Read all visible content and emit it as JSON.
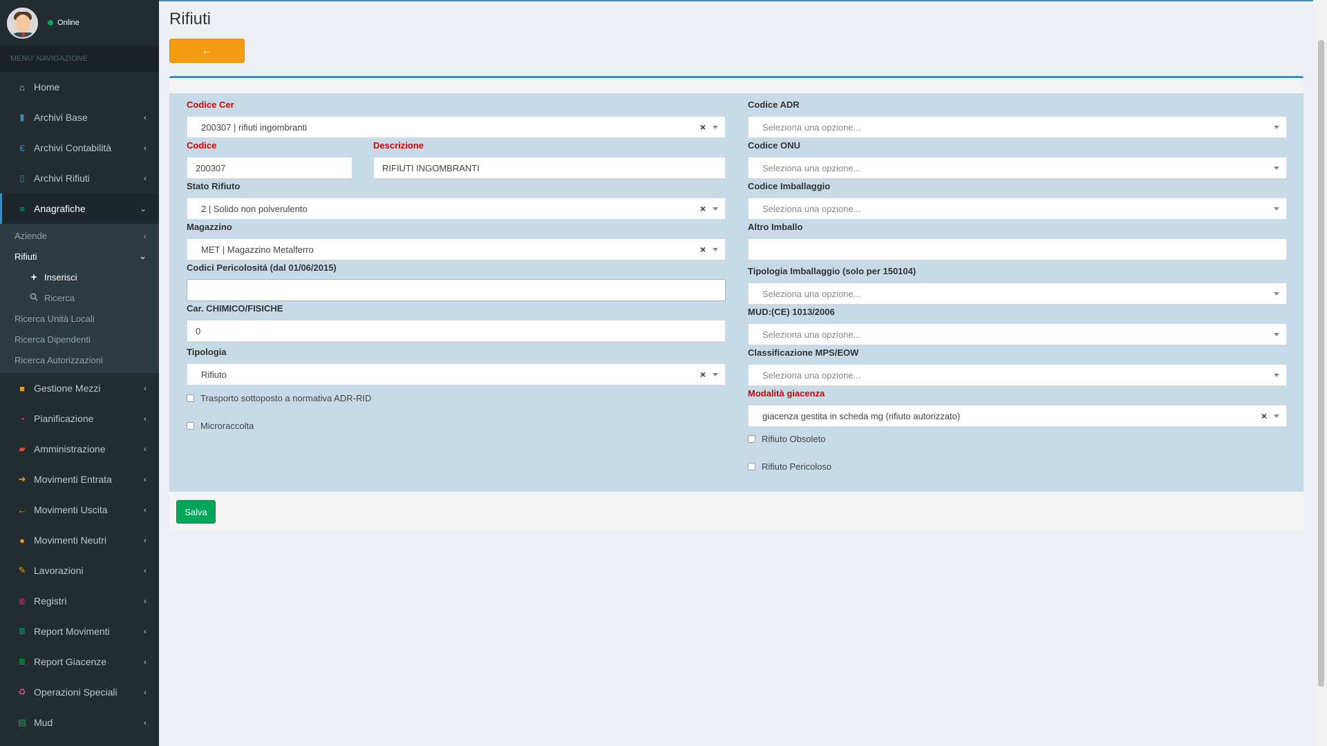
{
  "sidebar": {
    "status": "Online",
    "menu_header": "MENU' NAVIGAZIONE",
    "items": [
      {
        "label": "Home",
        "icon": "home-icon",
        "glyph": "⌂",
        "color": "#b8c7ce"
      },
      {
        "label": "Archivi Base",
        "icon": "book-icon",
        "glyph": "▮",
        "color": "#3c8dbc"
      },
      {
        "label": "Archivi Contabilità",
        "icon": "euro-icon",
        "glyph": "€",
        "color": "#3c8dbc"
      },
      {
        "label": "Archivi Rifiuti",
        "icon": "trash-icon",
        "glyph": "▯",
        "color": "#3c8dbc"
      },
      {
        "label": "Anagrafiche",
        "icon": "list-icon",
        "glyph": "≡",
        "color": "#00a65a"
      }
    ],
    "submenu": {
      "aziende": "Aziende",
      "rifiuti": "Rifiuti",
      "inserisci": "Inserisci",
      "ricerca": "Ricerca",
      "ricerca_unita": "Ricerca Unità Locali",
      "ricerca_dipendenti": "Ricerca Dipendenti",
      "ricerca_autorizzazioni": "Ricerca Autorizzazioni"
    },
    "items2": [
      {
        "label": "Gestione Mezzi",
        "icon": "truck-icon",
        "glyph": "■",
        "color": "#f39c12"
      },
      {
        "label": "Pianificazione",
        "icon": "clock-icon",
        "glyph": "◔",
        "color": "#e83e8c"
      },
      {
        "label": "Amministrazione",
        "icon": "folder-open-icon",
        "glyph": "▰",
        "color": "#dd4b39"
      },
      {
        "label": "Movimenti Entrata",
        "icon": "arrow-right-icon",
        "glyph": "➜",
        "color": "#f39c12"
      },
      {
        "label": "Movimenti Uscita",
        "icon": "arrow-left-icon",
        "glyph": "←",
        "color": "#f39c12"
      },
      {
        "label": "Movimenti Neutri",
        "icon": "arrow-circle-down-icon",
        "glyph": "●",
        "color": "#f39c12"
      },
      {
        "label": "Lavorazioni",
        "icon": "wrench-icon",
        "glyph": "✎",
        "color": "#f39c12"
      },
      {
        "label": "Registri",
        "icon": "registered-icon",
        "glyph": "®",
        "color": "#e83e8c"
      },
      {
        "label": "Report Movimenti",
        "icon": "database-icon",
        "glyph": "≣",
        "color": "#00a65a"
      },
      {
        "label": "Report Giacenze",
        "icon": "database-icon",
        "glyph": "≣",
        "color": "#00a65a"
      },
      {
        "label": "Operazioni Speciali",
        "icon": "recycle-icon",
        "glyph": "♻",
        "color": "#e83e8c"
      },
      {
        "label": "Mud",
        "icon": "file-pdf-icon",
        "glyph": "▤",
        "color": "#00a65a"
      }
    ]
  },
  "page": {
    "title": "Rifiuti",
    "back_icon": "←",
    "save_label": "Salva"
  },
  "form": {
    "codice_cer": {
      "label": "Codice Cer",
      "value": "200307 | rifiuti ingombranti"
    },
    "codice": {
      "label": "Codice",
      "value": "200307"
    },
    "descrizione": {
      "label": "Descrizione",
      "value": "RIFIUTI INGOMBRANTI"
    },
    "stato_rifiuto": {
      "label": "Stato Rifiuto",
      "value": "2 | Solido non polverulento"
    },
    "magazzino": {
      "label": "Magazzino",
      "value": "MET | Magazzino Metalferro"
    },
    "codici_pericolosita": {
      "label": "Codici Pericolositá (dal 01/06/2015)",
      "value": ""
    },
    "car_chimico": {
      "label": "Car. CHIMICO/FISICHE",
      "value": "0"
    },
    "tipologia": {
      "label": "Tipologia",
      "value": "Rifiuto"
    },
    "trasporto_adr": {
      "label": "Trasporto sottoposto a normativa ADR-RID",
      "checked": false
    },
    "microraccolta": {
      "label": "Microraccolta",
      "checked": false
    },
    "codice_adr": {
      "label": "Codice ADR",
      "placeholder": "Seleziona una opzione..."
    },
    "codice_onu": {
      "label": "Codice ONU",
      "placeholder": "Seleziona una opzione..."
    },
    "codice_imballaggio": {
      "label": "Codice Imballaggio",
      "placeholder": "Seleziona una opzione..."
    },
    "altro_imballo": {
      "label": "Altro Imballo",
      "value": ""
    },
    "tipologia_imballaggio": {
      "label": "Tipologia Imballaggio (solo per 150104)",
      "placeholder": "Seleziona una opzione..."
    },
    "mud": {
      "label": "MUD:(CE) 1013/2006",
      "placeholder": "Seleziona una opzione..."
    },
    "classificazione": {
      "label": "Classificazione MPS/EOW",
      "placeholder": "Seleziona una opzione..."
    },
    "modalita_giacenza": {
      "label": "Modalità giacenza",
      "value": "giacenza gestita in scheda mg (rifiuto autorizzato)"
    },
    "rifiuto_obsoleto": {
      "label": "Rifiuto Obsoleto",
      "checked": false
    },
    "rifiuto_pericoloso": {
      "label": "Rifiuto Pericoloso",
      "checked": false
    }
  },
  "colors": {
    "sidebar_bg": "#222d32",
    "accent": "#3c8dbc",
    "warning": "#f39c12",
    "success": "#00a65a",
    "required_label": "#dd0000",
    "form_bg": "#c6dae7"
  }
}
